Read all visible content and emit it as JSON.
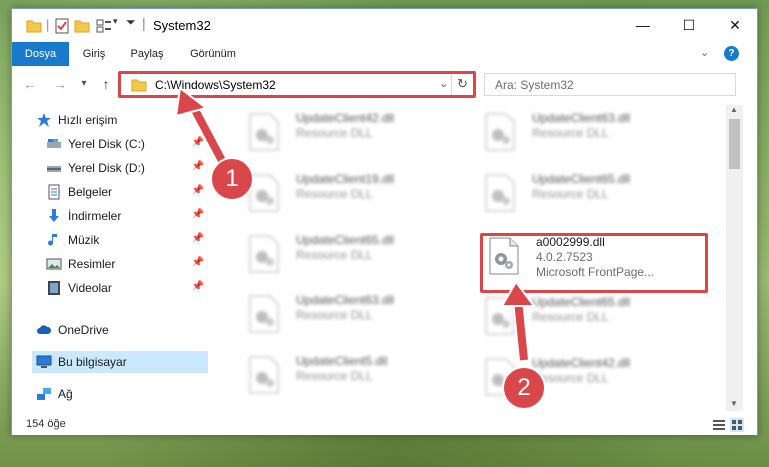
{
  "window": {
    "title": "System32",
    "minimize": "—",
    "maximize": "☐",
    "close": "✕"
  },
  "ribbon": {
    "tabs": [
      "Dosya",
      "Giriş",
      "Paylaş",
      "Görünüm"
    ],
    "help": "?"
  },
  "nav": {
    "back": "←",
    "forward": "→",
    "recent": "▾",
    "up": "↑",
    "address": "C:\\Windows\\System32",
    "search_placeholder": "Ara: System32",
    "refresh": "↻"
  },
  "sidebar": {
    "items": [
      {
        "label": "Hızlı erişim",
        "icon": "star-icon"
      },
      {
        "label": "Yerel Disk (C:)",
        "icon": "drive-icon"
      },
      {
        "label": "Yerel Disk (D:)",
        "icon": "drive-icon"
      },
      {
        "label": "Belgeler",
        "icon": "document-icon"
      },
      {
        "label": "İndirmeler",
        "icon": "download-icon"
      },
      {
        "label": "Müzik",
        "icon": "music-icon"
      },
      {
        "label": "Resimler",
        "icon": "pictures-icon"
      },
      {
        "label": "Videolar",
        "icon": "video-icon"
      },
      {
        "label": "OneDrive",
        "icon": "cloud-icon"
      },
      {
        "label": "Bu bilgisayar",
        "icon": "computer-icon"
      },
      {
        "label": "Ağ",
        "icon": "network-icon"
      }
    ]
  },
  "files": [
    {
      "name": "UpdateClient42.dll",
      "desc": "Resource DLL"
    },
    {
      "name": "UpdateClient63.dll",
      "desc": "Resource DLL"
    },
    {
      "name": "UpdateClient19.dll",
      "desc": "Resource DLL"
    },
    {
      "name": "UpdateClient65.dll",
      "desc": "Resource DLL"
    },
    {
      "name": "UpdateClient65.dll",
      "desc": "Resource DLL"
    },
    {
      "name": "UpdateClient63.dll",
      "desc": "Resource DLL"
    },
    {
      "name": "UpdateClient65.dll",
      "desc": "Resource DLL"
    },
    {
      "name": "UpdateClient5.dll",
      "desc": "Resource DLL"
    },
    {
      "name": "UpdateClient42.dll",
      "desc": "Resource DLL"
    }
  ],
  "highlighted_file": {
    "name": "a0002999.dll",
    "version": "4.0.2.7523",
    "desc": "Microsoft FrontPage..."
  },
  "status": {
    "count": "154 öğe"
  },
  "callouts": [
    "1",
    "2"
  ],
  "colors": {
    "accent": "#1979ca",
    "highlight": "#d9474a",
    "selection": "#cce8ff"
  }
}
